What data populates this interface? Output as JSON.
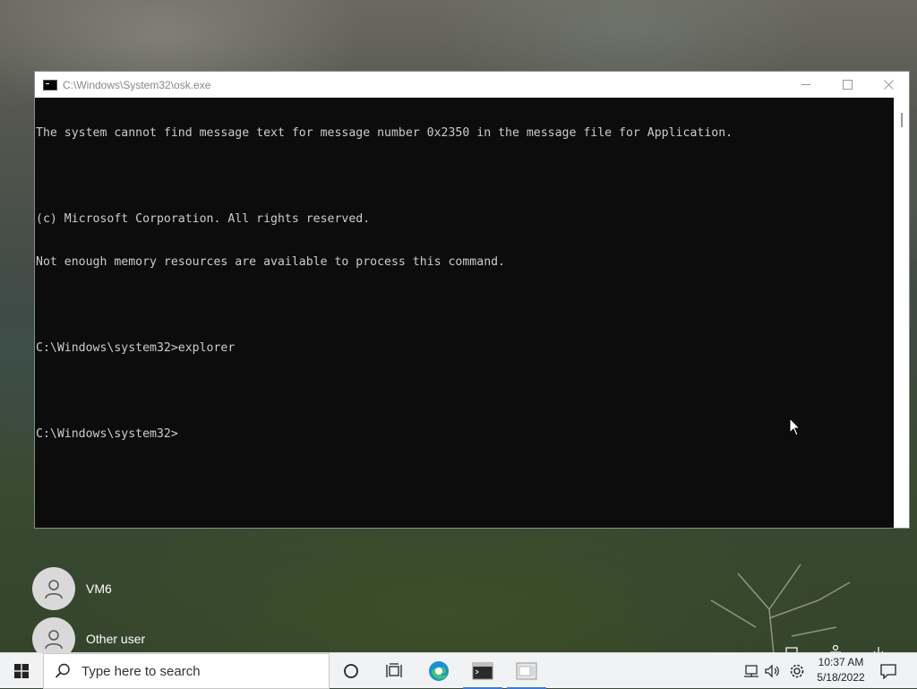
{
  "window": {
    "title": "C:\\Windows\\System32\\osk.exe",
    "icon": "console-icon",
    "controls": [
      "minimize-icon",
      "maximize-icon",
      "close-icon"
    ]
  },
  "console": {
    "lines": [
      "The system cannot find message text for message number 0x2350 in the message file for Application.",
      "",
      "(c) Microsoft Corporation. All rights reserved.",
      "Not enough memory resources are available to process this command.",
      "",
      "C:\\Windows\\system32>explorer",
      "",
      "C:\\Windows\\system32>"
    ],
    "background": "#0c0c0c",
    "text_color": "#cccccc"
  },
  "login": {
    "users": [
      {
        "name": "VM6"
      },
      {
        "name": "Other user"
      }
    ],
    "corner_icons": [
      "network-icon",
      "accessibility-icon",
      "power-icon"
    ]
  },
  "taskbar": {
    "search_placeholder": "Type here to search",
    "items": [
      "cortana-icon",
      "task-view-icon",
      "edge-icon",
      "command-prompt-icon",
      "osk-icon"
    ],
    "tray": [
      "network-icon",
      "volume-icon",
      "settings-icon",
      "notifications-icon"
    ],
    "time": "10:37 AM",
    "date": "5/18/2022",
    "accent": "#3a7bd5"
  }
}
